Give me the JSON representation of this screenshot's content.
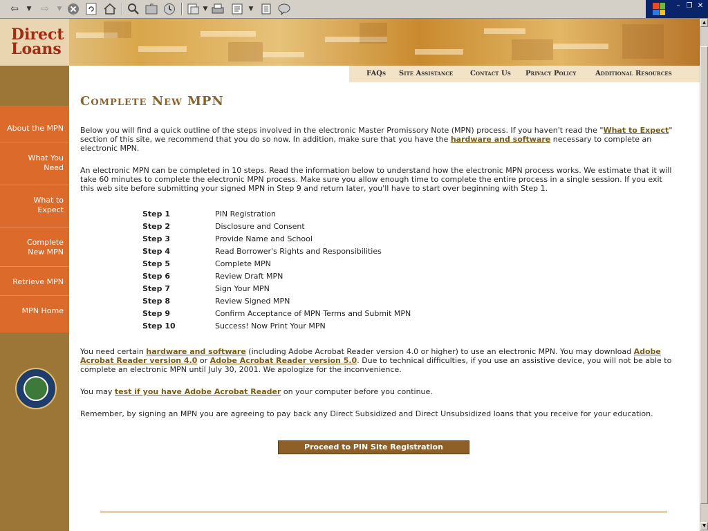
{
  "browser": {
    "toolbar_icons": [
      "back-icon",
      "dropdown-icon",
      "forward-icon",
      "dropdown-icon",
      "stop-icon",
      "refresh-icon",
      "home-icon",
      "search-icon",
      "favorites-icon",
      "history-icon",
      "mail-icon",
      "dropdown-icon",
      "print-icon",
      "edit-icon",
      "dropdown-icon",
      "discuss-icon",
      "messenger-icon"
    ]
  },
  "banner": {
    "logo_line1": "Direct",
    "logo_line2": "Loans"
  },
  "topnav": {
    "faqs": "FAQs",
    "site_assistance": "Site Assistance",
    "contact_us": "Contact Us",
    "privacy_policy": "Privacy Policy",
    "additional_resources": "Additional Resources"
  },
  "sidebar": {
    "items": [
      {
        "line1": "About the MPN",
        "line2": ""
      },
      {
        "line1": "What You",
        "line2": "Need"
      },
      {
        "line1": "What to",
        "line2": "Expect"
      },
      {
        "line1": "Complete",
        "line2": "New MPN"
      },
      {
        "line1": "Retrieve MPN",
        "line2": ""
      },
      {
        "line1": "MPN Home",
        "line2": ""
      }
    ]
  },
  "page": {
    "title": "Complete New MPN",
    "intro": {
      "t1": "Below you will find a quick outline of the steps involved in the electronic Master Promissory Note (MPN) process. If you haven't read the \"",
      "link1": "What to Expect",
      "t2": "\" section of this site, we recommend that you do so now. In addition, make sure that you have the ",
      "link2": "hardware and software",
      "t3": " necessary to complete an electronic MPN."
    },
    "para2": "An electronic MPN can be completed in 10 steps. Read the information below to understand how the electronic MPN process works. We estimate that it will take 60 minutes to complete the electronic MPN process. Make sure you allow enough time to complete the entire process in a single session. If you exit this web site before submitting your signed MPN in Step 9 and return later, you'll have to start over beginning with Step 1.",
    "steps": [
      {
        "label": "Step 1",
        "desc": "PIN Registration"
      },
      {
        "label": "Step 2",
        "desc": "Disclosure and Consent"
      },
      {
        "label": "Step 3",
        "desc": "Provide Name and School"
      },
      {
        "label": "Step 4",
        "desc": "Read Borrower's Rights and Responsibilities"
      },
      {
        "label": "Step 5",
        "desc": "Complete MPN"
      },
      {
        "label": "Step 6",
        "desc": "Review Draft MPN"
      },
      {
        "label": "Step 7",
        "desc": "Sign Your MPN"
      },
      {
        "label": "Step 8",
        "desc": "Review Signed MPN"
      },
      {
        "label": "Step 9",
        "desc": "Confirm Acceptance of MPN Terms and Submit MPN"
      },
      {
        "label": "Step 10",
        "desc": "Success! Now Print Your MPN"
      }
    ],
    "para3": {
      "t1": "You need certain ",
      "link1": "hardware and software",
      "t2": " (including Adobe Acrobat Reader version 4.0 or higher) to use an electronic MPN. You may download ",
      "link2": "Adobe Acrobat Reader version 4.0",
      "t3": " or ",
      "link3": "Adobe Acrobat Reader version 5.0",
      "t4": ". Due to technical difficulties, if you use an assistive device, you will not be able to complete an electronic MPN until July 30, 2001. We apologize for the inconvenience."
    },
    "para4": {
      "t1": "You may ",
      "link1": "test if you have Adobe Acrobat Reader",
      "t2": " on your computer before you continue."
    },
    "para5": "Remember, by signing an MPN you are agreeing to pay back any Direct Subsidized and Direct Unsubsidized loans that you receive for your education.",
    "proceed_button": "Proceed to PIN Site Registration"
  }
}
